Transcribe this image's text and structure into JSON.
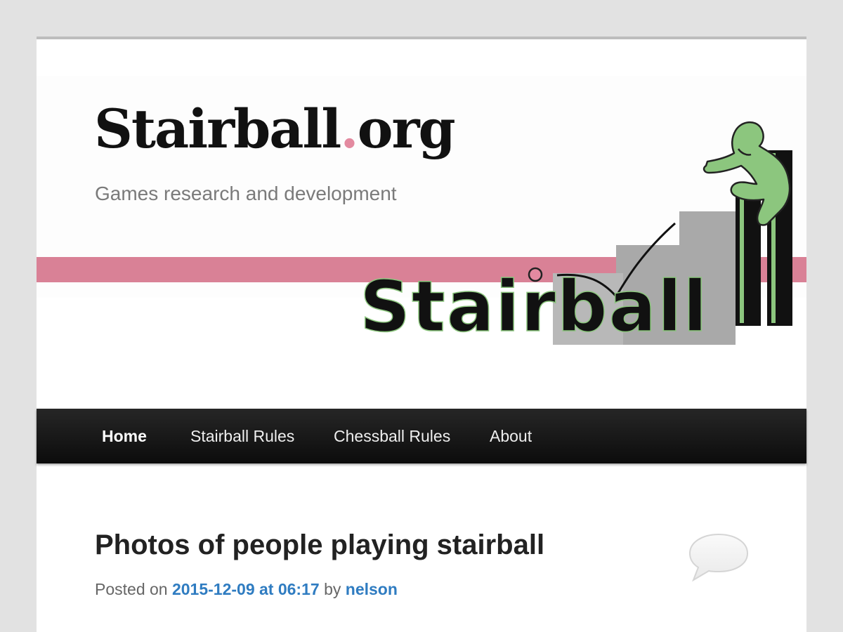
{
  "site": {
    "title_main": "Stairball",
    "title_dot": ".",
    "title_tld": "org",
    "description": "Games research and development",
    "logo_text": "Stairball"
  },
  "nav": {
    "items": [
      {
        "label": "Home",
        "active": true
      },
      {
        "label": "Stairball Rules",
        "active": false
      },
      {
        "label": "Chessball Rules",
        "active": false
      },
      {
        "label": "About",
        "active": false
      }
    ]
  },
  "post": {
    "title": "Photos of people playing stairball",
    "meta_prefix": "Posted on ",
    "date": "2015-12-09 at 06:17",
    "meta_by": " by ",
    "author": "nelson"
  },
  "icons": {
    "comment": "speech-bubble-icon"
  },
  "colors": {
    "accent_pink": "#d98196",
    "link_blue": "#2f7cc1",
    "figure_green": "#8cc67e",
    "nav_bg": "#1a1a1a"
  }
}
